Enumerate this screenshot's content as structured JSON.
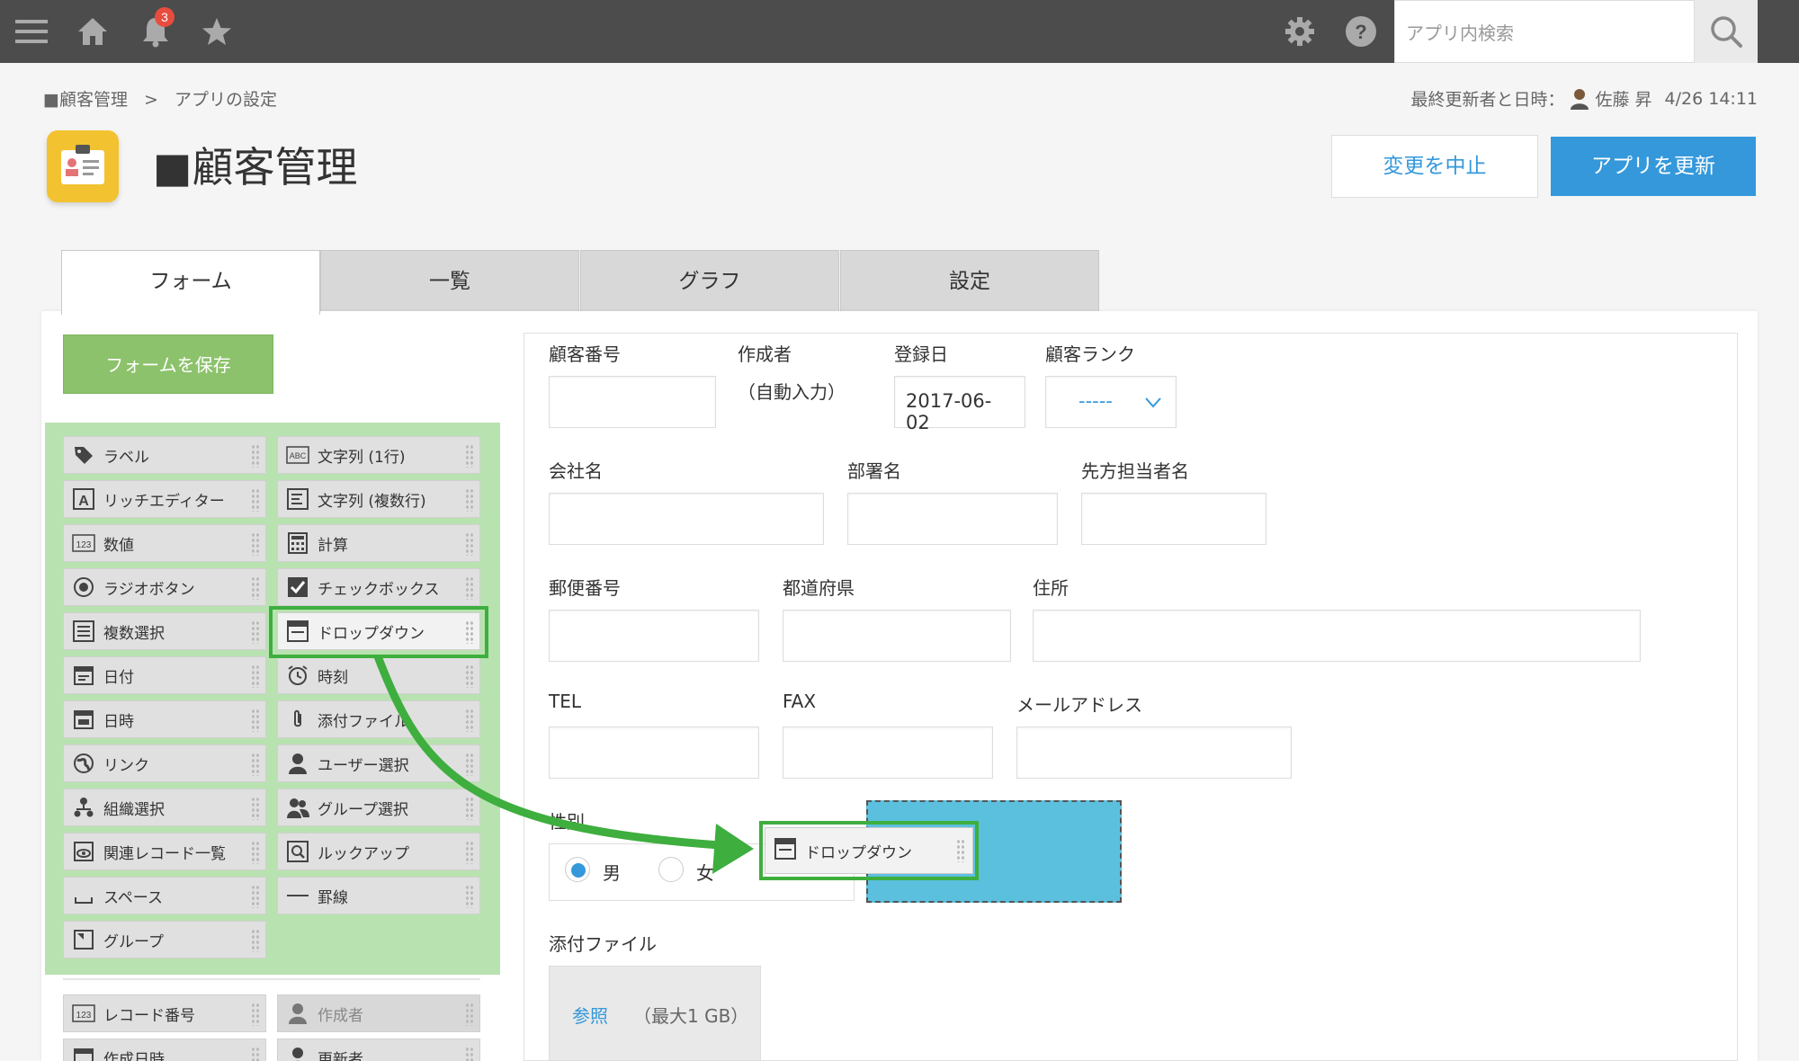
{
  "topbar": {
    "notification_count": "3",
    "search_placeholder": "アプリ内検索"
  },
  "breadcrumb": {
    "parent": "■顧客管理",
    "separator": ">",
    "current": "アプリの設定"
  },
  "updated": {
    "label": "最終更新者と日時：",
    "user": "佐藤 昇",
    "datetime": "4/26 14:11"
  },
  "app": {
    "title": "■顧客管理"
  },
  "actions": {
    "cancel_label": "変更を中止",
    "update_label": "アプリを更新"
  },
  "tabs": [
    {
      "label": "フォーム",
      "active": true
    },
    {
      "label": "一覧"
    },
    {
      "label": "グラフ"
    },
    {
      "label": "設定"
    }
  ],
  "save_form_label": "フォームを保存",
  "palette": {
    "left": [
      "ラベル",
      "リッチエディター",
      "数値",
      "ラジオボタン",
      "複数選択",
      "日付",
      "日時",
      "リンク",
      "組織選択",
      "関連レコード一覧",
      "スペース",
      "グループ"
    ],
    "right": [
      "文字列 (1行)",
      "文字列 (複数行)",
      "計算",
      "チェックボックス",
      "ドロップダウン",
      "時刻",
      "添付ファイル",
      "ユーザー選択",
      "グループ選択",
      "ルックアップ",
      "罫線"
    ],
    "system_left": [
      "レコード番号",
      "作成日時"
    ],
    "system_right": [
      "作成者",
      "更新者"
    ]
  },
  "form": {
    "customer_number_label": "顧客番号",
    "creator_label": "作成者",
    "creator_value": "（自動入力）",
    "registered_label": "登録日",
    "registered_value": "2017-06-02",
    "rank_label": "顧客ランク",
    "rank_value": "-----",
    "company_label": "会社名",
    "department_label": "部署名",
    "contact_label": "先方担当者名",
    "zip_label": "郵便番号",
    "prefecture_label": "都道府県",
    "address_label": "住所",
    "tel_label": "TEL",
    "fax_label": "FAX",
    "email_label": "メールアドレス",
    "gender_label": "性別",
    "gender_options": [
      "男",
      "女"
    ],
    "attachment_label": "添付ファイル",
    "browse_label": "参照",
    "max_size": "（最大1 GB）",
    "dragging_label": "ドロップダウン"
  },
  "colors": {
    "topbar": "#4c4c4c",
    "primary": "#3498db",
    "save": "#8cc26b",
    "palette_bg": "#b9e2b1",
    "highlight": "#3eae3e",
    "drop_target": "#5bc0de"
  }
}
